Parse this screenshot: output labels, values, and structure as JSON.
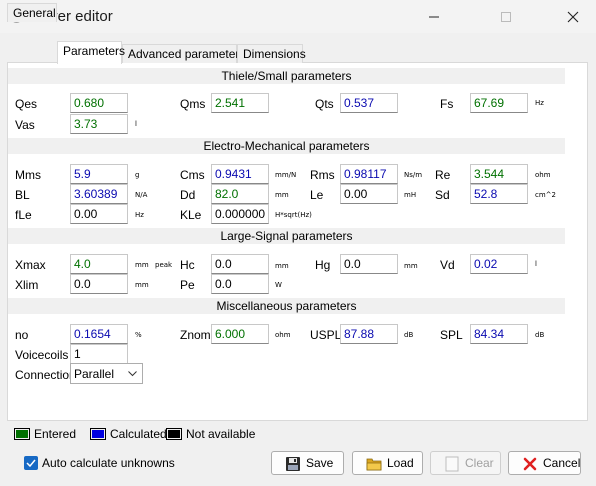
{
  "window": {
    "title": "Driver editor"
  },
  "tabs": [
    {
      "label": "General"
    },
    {
      "label": "Parameters"
    },
    {
      "label": "Advanced parameters"
    },
    {
      "label": "Dimensions"
    }
  ],
  "sections": {
    "ts": "Thiele/Small parameters",
    "em": "Electro-Mechanical parameters",
    "ls": "Large-Signal parameters",
    "misc": "Miscellaneous parameters"
  },
  "ts": {
    "qes": {
      "label": "Qes",
      "value": "0.680"
    },
    "qms": {
      "label": "Qms",
      "value": "2.541"
    },
    "qts": {
      "label": "Qts",
      "value": "0.537"
    },
    "fs": {
      "label": "Fs",
      "value": "67.69",
      "unit": "Hz"
    },
    "vas": {
      "label": "Vas",
      "value": "3.73",
      "unit": "l"
    }
  },
  "em": {
    "mms": {
      "label": "Mms",
      "value": "5.9",
      "unit": "g"
    },
    "cms": {
      "label": "Cms",
      "value": "0.9431",
      "unit": "mm/N"
    },
    "rms": {
      "label": "Rms",
      "value": "0.98117",
      "unit": "Ns/m"
    },
    "re": {
      "label": "Re",
      "value": "3.544",
      "unit": "ohm"
    },
    "bl": {
      "label": "BL",
      "value": "3.60389",
      "unit": "N/A"
    },
    "dd": {
      "label": "Dd",
      "value": "82.0",
      "unit": "mm"
    },
    "le": {
      "label": "Le",
      "value": "0.00",
      "unit": "mH"
    },
    "sd": {
      "label": "Sd",
      "value": "52.8",
      "unit": "cm^2"
    },
    "fle": {
      "label": "fLe",
      "value": "0.00",
      "unit": "Hz"
    },
    "kle": {
      "label": "KLe",
      "value": "0.000000",
      "unit": "H*sqrt(Hz)"
    }
  },
  "ls": {
    "xmax": {
      "label": "Xmax",
      "value": "4.0",
      "unit": "mm",
      "unit2": "peak"
    },
    "hc": {
      "label": "Hc",
      "value": "0.0",
      "unit": "mm"
    },
    "hg": {
      "label": "Hg",
      "value": "0.0",
      "unit": "mm"
    },
    "vd": {
      "label": "Vd",
      "value": "0.02",
      "unit": "l"
    },
    "xlim": {
      "label": "Xlim",
      "value": "0.0",
      "unit": "mm"
    },
    "pe": {
      "label": "Pe",
      "value": "0.0",
      "unit": "W"
    }
  },
  "misc": {
    "no": {
      "label": "no",
      "value": "0.1654",
      "unit": "%"
    },
    "znom": {
      "label": "Znom",
      "value": "6.000",
      "unit": "ohm"
    },
    "uspl": {
      "label": "USPL",
      "value": "87.88",
      "unit": "dB"
    },
    "spl": {
      "label": "SPL",
      "value": "84.34",
      "unit": "dB"
    },
    "voicecoils": {
      "label": "Voicecoils",
      "value": "1"
    },
    "connection": {
      "label": "Connection",
      "value": "Parallel"
    }
  },
  "legend": {
    "entered": "Entered",
    "calculated": "Calculated",
    "not_available": "Not available",
    "colors": {
      "entered": "#007000",
      "calculated": "#0000e0",
      "not_available": "#000000"
    }
  },
  "footer": {
    "auto_calc_label": "Auto calculate unknowns",
    "auto_calc_checked": true,
    "save": "Save",
    "load": "Load",
    "clear": "Clear",
    "cancel": "Cancel"
  }
}
